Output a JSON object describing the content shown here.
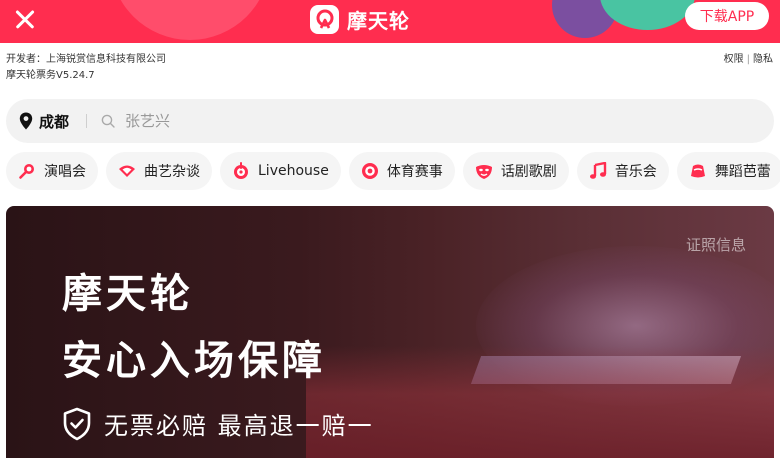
{
  "topbar": {
    "close_label": "close",
    "brand_name": "摩天轮",
    "download_label": "下载APP"
  },
  "info": {
    "developer": "开发者：上海锐赏信息科技有限公司",
    "version": "摩天轮票务V5.24.7",
    "permissions": "权限",
    "separator": "|",
    "privacy": "隐私"
  },
  "search": {
    "city": "成都",
    "placeholder": "张艺兴"
  },
  "categories": [
    {
      "label": "演唱会",
      "icon": "microphone-icon"
    },
    {
      "label": "曲艺杂谈",
      "icon": "fan-icon"
    },
    {
      "label": "Livehouse",
      "icon": "livehouse-icon"
    },
    {
      "label": "体育赛事",
      "icon": "ball-icon"
    },
    {
      "label": "话剧歌剧",
      "icon": "mask-icon"
    },
    {
      "label": "音乐会",
      "icon": "music-note-icon"
    },
    {
      "label": "舞蹈芭蕾",
      "icon": "ballet-shoe-icon"
    }
  ],
  "hero": {
    "cert_label": "证照信息",
    "title": "摩天轮",
    "subtitle": "安心入场保障",
    "guarantee": "无票必赔  最高退一赔一"
  },
  "colors": {
    "brand": "#ff2d4f",
    "accent_purple": "#7b4fa0",
    "accent_green": "#49c4a2"
  }
}
